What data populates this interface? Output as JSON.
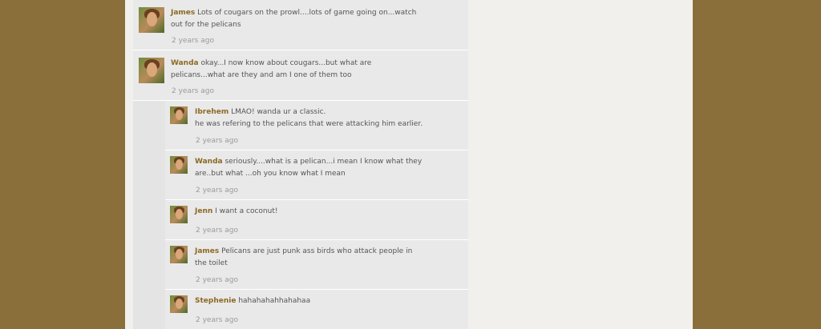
{
  "comments": [
    {
      "author": "James",
      "text": "Lots of cougars on the prowl....lots of game going on...watch out for the pelicans",
      "time": "2 years ago"
    },
    {
      "author": "Wanda",
      "text": "okay...I now know about cougars...but what are pelicans...what are they and am I one of them too",
      "time": "2 years ago"
    },
    {
      "author": "Ibrehem",
      "text": "LMAO! wanda ur a classic.",
      "text2": "he was refering to the pelicans that were attacking him earlier.",
      "time": "2 years ago"
    },
    {
      "author": "Wanda",
      "text": "seriously....what is a pelican...i mean I know what they are..but what ...oh you know what I mean",
      "time": "2 years ago"
    },
    {
      "author": "Jenn",
      "text": "I want a coconut!",
      "time": "2 years ago"
    },
    {
      "author": "James",
      "text": "Pelicans are just punk ass birds who attack people in the toilet",
      "time": "2 years ago"
    },
    {
      "author": "Stephenie",
      "text": "hahahahahhahahaa",
      "time": "2 years ago"
    }
  ]
}
